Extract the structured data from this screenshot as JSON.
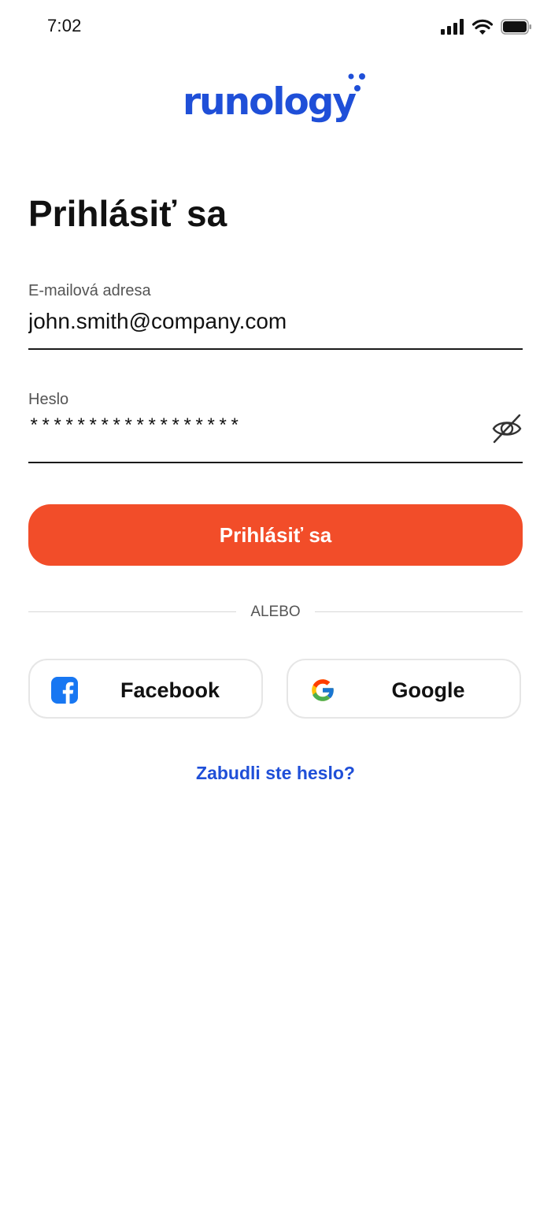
{
  "status_bar": {
    "time": "7:02",
    "icons": [
      "signal-icon",
      "wifi-icon",
      "battery-icon"
    ]
  },
  "brand": {
    "logo_text": "runology",
    "color": "#1f4fd8"
  },
  "page": {
    "title": "Prihlásiť sa"
  },
  "form": {
    "email": {
      "label": "E-mailová adresa",
      "value": "john.smith@company.com"
    },
    "password": {
      "label": "Heslo",
      "value": "******************",
      "toggle_icon": "eye-off-icon"
    },
    "submit_label": "Prihlásiť sa",
    "submit_color": "#f24d29"
  },
  "divider": {
    "text": "ALEBO"
  },
  "social": {
    "facebook": {
      "label": "Facebook",
      "icon": "facebook-icon",
      "color": "#1877f2"
    },
    "google": {
      "label": "Google",
      "icon": "google-icon"
    }
  },
  "links": {
    "forgot_password": "Zabudli ste heslo?"
  }
}
